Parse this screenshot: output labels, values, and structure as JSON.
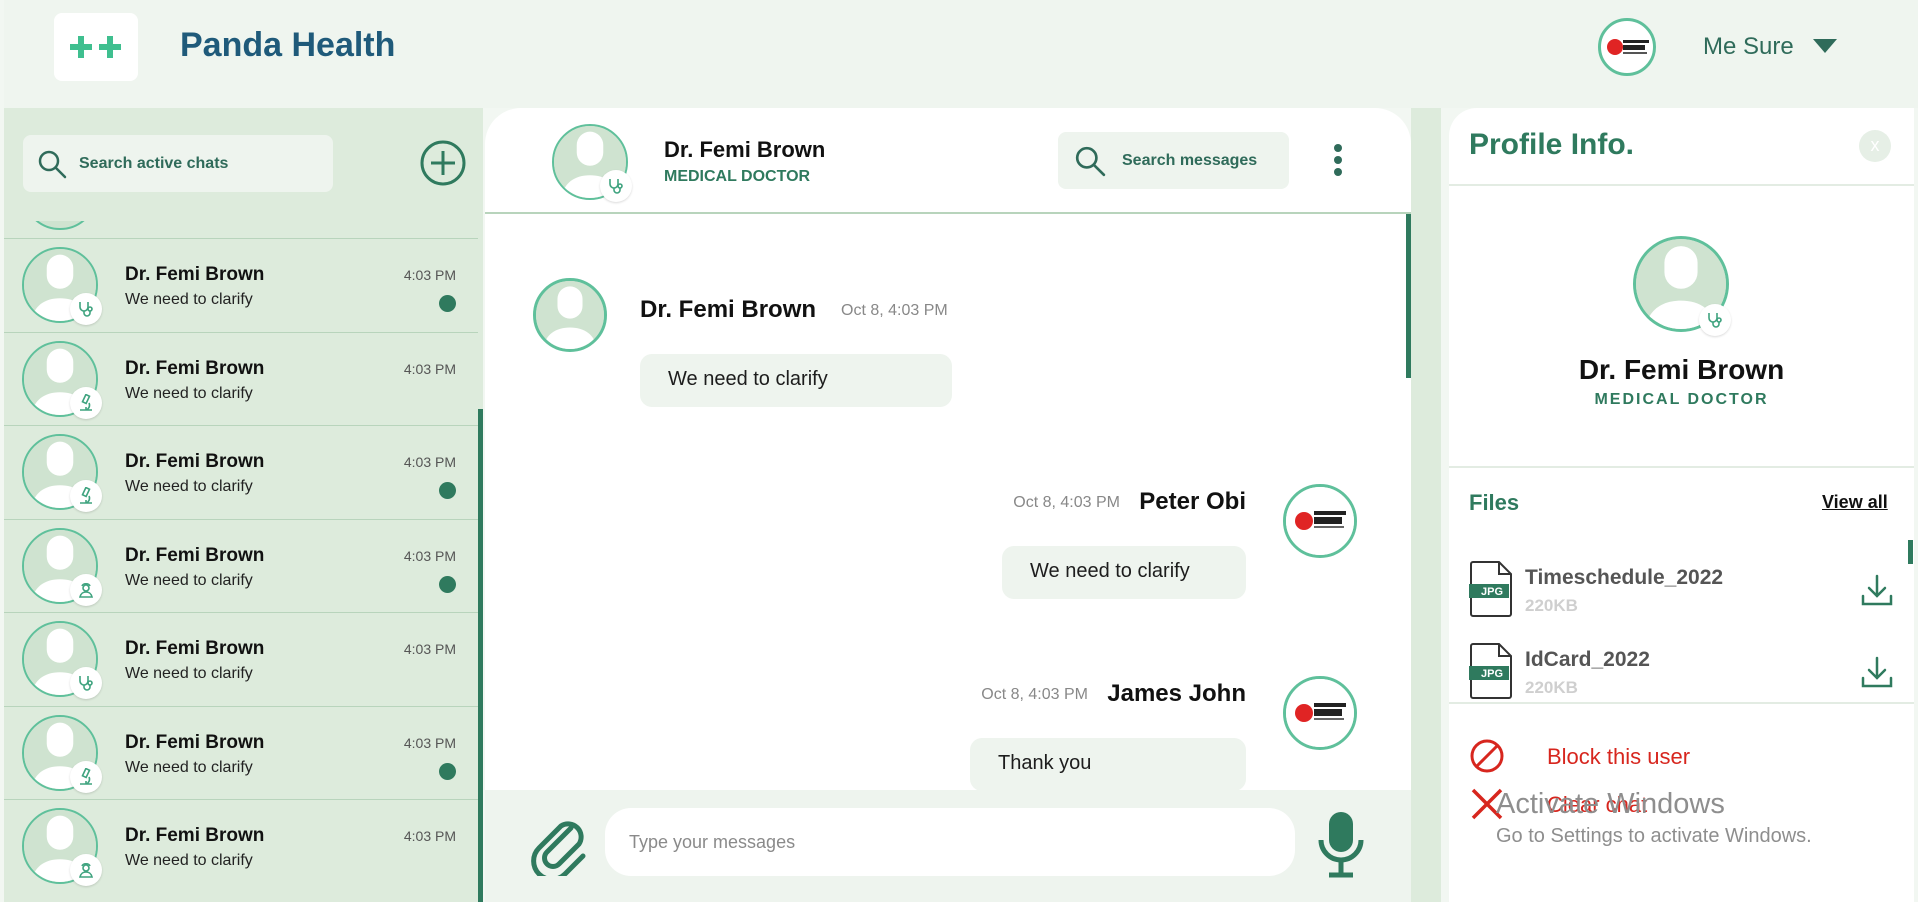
{
  "header": {
    "app_title": "Panda Health",
    "user_name": "Me Sure",
    "brand_color": "#2f7a5e"
  },
  "chat_list": {
    "search_placeholder": "Search active chats",
    "items": [
      {
        "name": "Dr. Femi Brown",
        "preview": "We need to clarify",
        "time": "4:03 PM",
        "badge": "stethoscope-icon",
        "unread": true
      },
      {
        "name": "Dr. Femi Brown",
        "preview": "We need to clarify",
        "time": "4:03 PM",
        "badge": "microscope-icon",
        "unread": false
      },
      {
        "name": "Dr. Femi Brown",
        "preview": "We need to clarify",
        "time": "4:03 PM",
        "badge": "microscope-icon",
        "unread": true
      },
      {
        "name": "Dr. Femi Brown",
        "preview": "We need to clarify",
        "time": "4:03 PM",
        "badge": "nurse-icon",
        "unread": true
      },
      {
        "name": "Dr. Femi Brown",
        "preview": "We need to clarify",
        "time": "4:03 PM",
        "badge": "stethoscope-icon",
        "unread": false
      },
      {
        "name": "Dr. Femi Brown",
        "preview": "We need to clarify",
        "time": "4:03 PM",
        "badge": "microscope-icon",
        "unread": true
      },
      {
        "name": "Dr. Femi Brown",
        "preview": "We need to clarify",
        "time": "4:03 PM",
        "badge": "nurse-icon",
        "unread": false
      }
    ]
  },
  "conversation": {
    "name": "Dr. Femi Brown",
    "role": "MEDICAL DOCTOR",
    "search_label": "Search messages",
    "messages": [
      {
        "sender": "Dr. Femi Brown",
        "time": "Oct 8, 4:03 PM",
        "text": "We need to clarify",
        "side": "left"
      },
      {
        "sender": "Peter Obi",
        "time": "Oct 8, 4:03 PM",
        "text": "We need to clarify",
        "side": "right"
      },
      {
        "sender": "James John",
        "time": "Oct 8, 4:03 PM",
        "text": "Thank you",
        "side": "right"
      }
    ],
    "input_placeholder": "Type your messages"
  },
  "profile": {
    "title": "Profile Info.",
    "close_label": "x",
    "name": "Dr. Femi Brown",
    "role": "MEDICAL DOCTOR",
    "files_title": "Files",
    "view_all": "View all",
    "files": [
      {
        "name": "Timeschedule_2022",
        "size": "220KB",
        "type": "JPG"
      },
      {
        "name": "IdCard_2022",
        "size": "220KB",
        "type": "JPG"
      }
    ],
    "block_label": "Block this user",
    "clear_label": "Clear chat"
  },
  "watermark": {
    "title": "Activate Windows",
    "subtitle": "Go to Settings to activate Windows."
  }
}
